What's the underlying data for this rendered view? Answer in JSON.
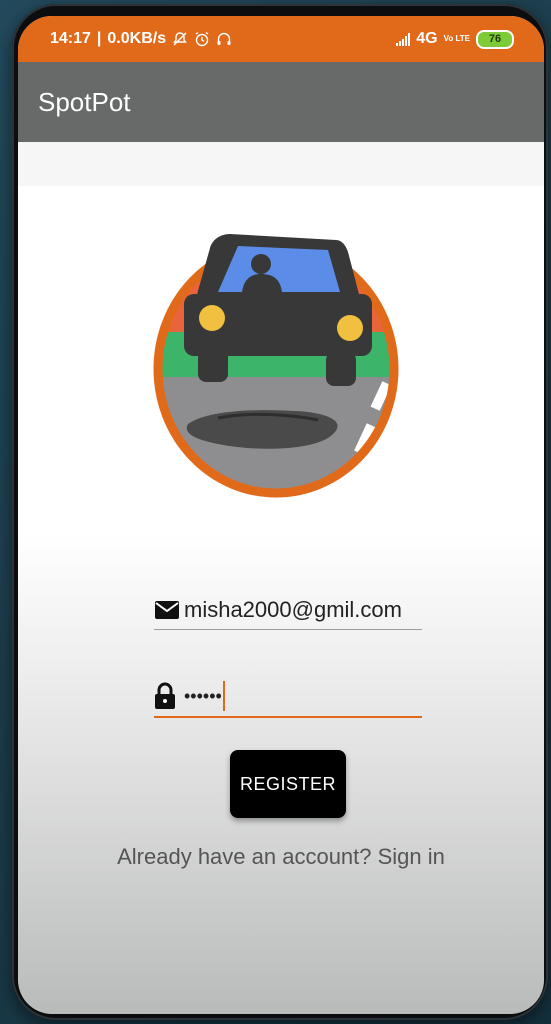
{
  "status_bar": {
    "time": "14:17",
    "speed": "0.0KB/s",
    "network": "4G",
    "volte": "Vo LTE",
    "battery": "76"
  },
  "app_bar": {
    "title": "SpotPot"
  },
  "logo": {
    "icon": "car-over-pothole-icon"
  },
  "form": {
    "email": {
      "icon": "mail-icon",
      "value": "misha2000@gmil.com"
    },
    "password": {
      "icon": "lock-icon",
      "value": "••••••"
    },
    "register_label": "REGISTER",
    "signin_text": "Already  have an account? Sign in"
  },
  "colors": {
    "accent": "#e06a1a",
    "app_bar": "#676a68",
    "button": "#000000"
  }
}
